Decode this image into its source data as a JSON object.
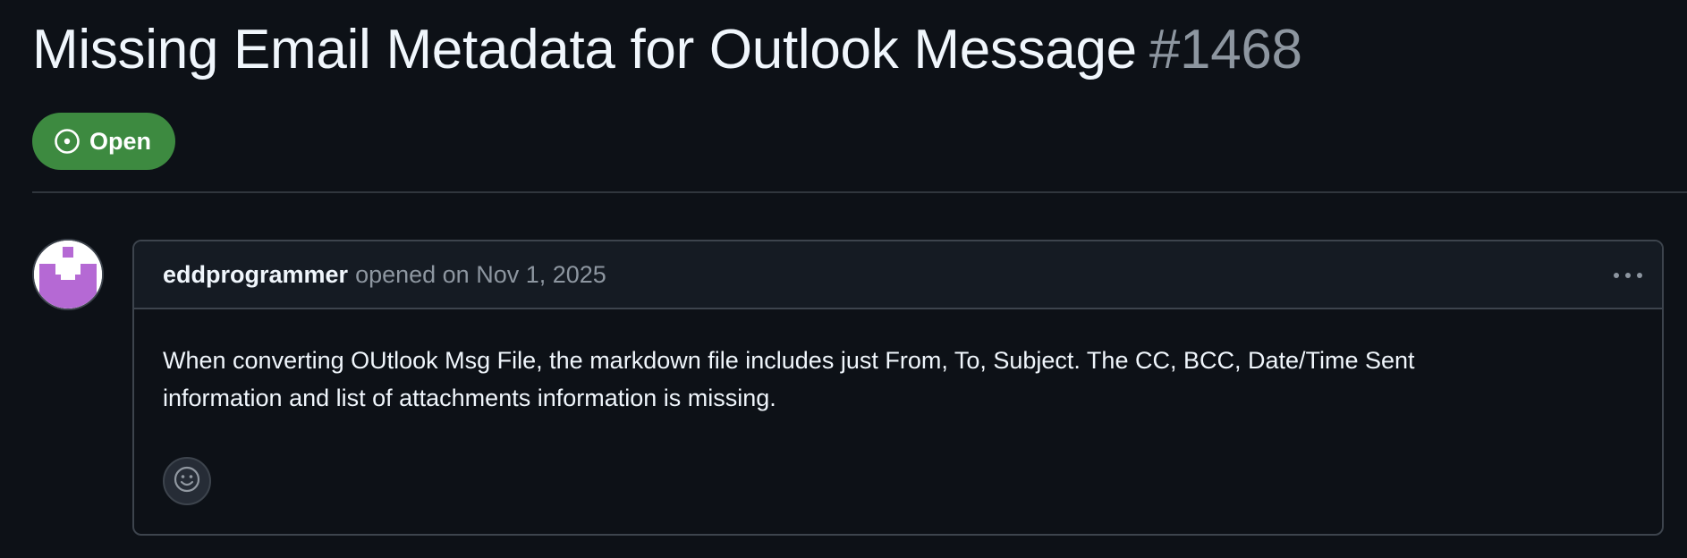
{
  "issue": {
    "title": "Missing Email Metadata for Outlook Message",
    "number": "#1468",
    "state": "Open",
    "state_icon": "issue-opened-icon",
    "state_color": "#3d8a40"
  },
  "comment": {
    "author": "eddprogrammer",
    "opened_text": "opened on Nov 1, 2025",
    "body": "When converting OUtlook Msg File, the markdown file includes just From, To, Subject. The CC, BCC, Date/Time Sent information and list of attachments information is missing.",
    "menu_icon": "kebab-horizontal-icon",
    "reaction_icon": "smiley-icon"
  },
  "colors": {
    "background": "#0d1117",
    "header_background": "#151b23",
    "border": "#3d444d",
    "muted_text": "#8d96a0",
    "avatar_accent": "#b569d4"
  }
}
